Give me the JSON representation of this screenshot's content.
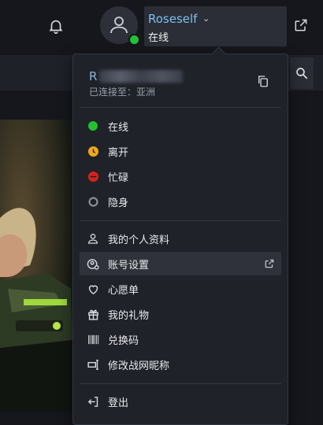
{
  "header": {
    "username": "Roseself",
    "status": "在线",
    "colors": {
      "online": "#25c036",
      "name": "#7ec0f2"
    }
  },
  "menu": {
    "account_name_prefix": "R",
    "region": "已连接至：亚洲",
    "statuses": [
      {
        "label": "在线",
        "color": "#22c02f",
        "icon": "online-dot-icon"
      },
      {
        "label": "离开",
        "color": "#f0a818",
        "icon": "away-clock-icon"
      },
      {
        "label": "忙碌",
        "color": "#d9221d",
        "icon": "busy-minus-icon"
      },
      {
        "label": "隐身",
        "color": "#8a9099",
        "icon": "invisible-ring-icon"
      }
    ],
    "items": [
      {
        "label": "我的个人资料",
        "icon": "user-icon"
      },
      {
        "label": "账号设置",
        "icon": "account-settings-icon",
        "external": true
      },
      {
        "label": "心愿单",
        "icon": "heart-icon"
      },
      {
        "label": "我的礼物",
        "icon": "gift-icon"
      },
      {
        "label": "兑换码",
        "icon": "barcode-icon"
      },
      {
        "label": "修改战网昵称",
        "icon": "rename-icon"
      }
    ],
    "logout": {
      "label": "登出",
      "icon": "logout-icon"
    }
  }
}
